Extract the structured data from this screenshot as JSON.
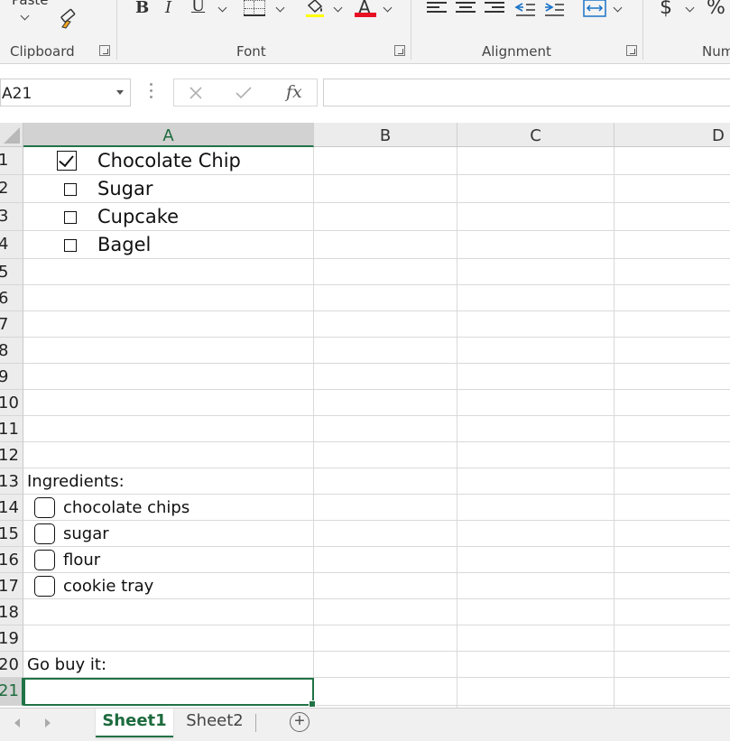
{
  "ribbon": {
    "paste_label": "Paste",
    "groups": {
      "clipboard": "Clipboard",
      "font": "Font",
      "alignment": "Alignment",
      "number": "Num"
    },
    "font": {
      "bold": "B",
      "italic": "I",
      "underline": "U",
      "font_color_letter": "A",
      "font_color": "#e81123"
    },
    "number": {
      "currency": "$",
      "percent": "%"
    }
  },
  "formula_bar": {
    "name_box": "A21",
    "fx_label": "fx",
    "formula": ""
  },
  "columns": [
    "A",
    "B",
    "C",
    "D"
  ],
  "selected_column": "A",
  "rows": [
    "1",
    "2",
    "3",
    "4",
    "5",
    "6",
    "7",
    "8",
    "9",
    "10",
    "11",
    "12",
    "13",
    "14",
    "15",
    "16",
    "17",
    "18",
    "19",
    "20",
    "21"
  ],
  "selected_row": "21",
  "cells": {
    "a1": "Chocolate Chip",
    "a2": "Sugar",
    "a3": "Cupcake",
    "a4": "Bagel",
    "a13": "Ingredients:",
    "a14": "chocolate chips",
    "a15": "sugar",
    "a16": "flour",
    "a17": "cookie tray",
    "a20": "Go buy it:"
  },
  "checkboxes": {
    "a1": true,
    "a2": false,
    "a3": false,
    "a4": false,
    "a14": false,
    "a15": false,
    "a16": false,
    "a17": false
  },
  "sheets": {
    "tab1": "Sheet1",
    "tab2": "Sheet2",
    "active": "Sheet1"
  },
  "colors": {
    "accent": "#217346",
    "header_bg": "#ececec"
  }
}
